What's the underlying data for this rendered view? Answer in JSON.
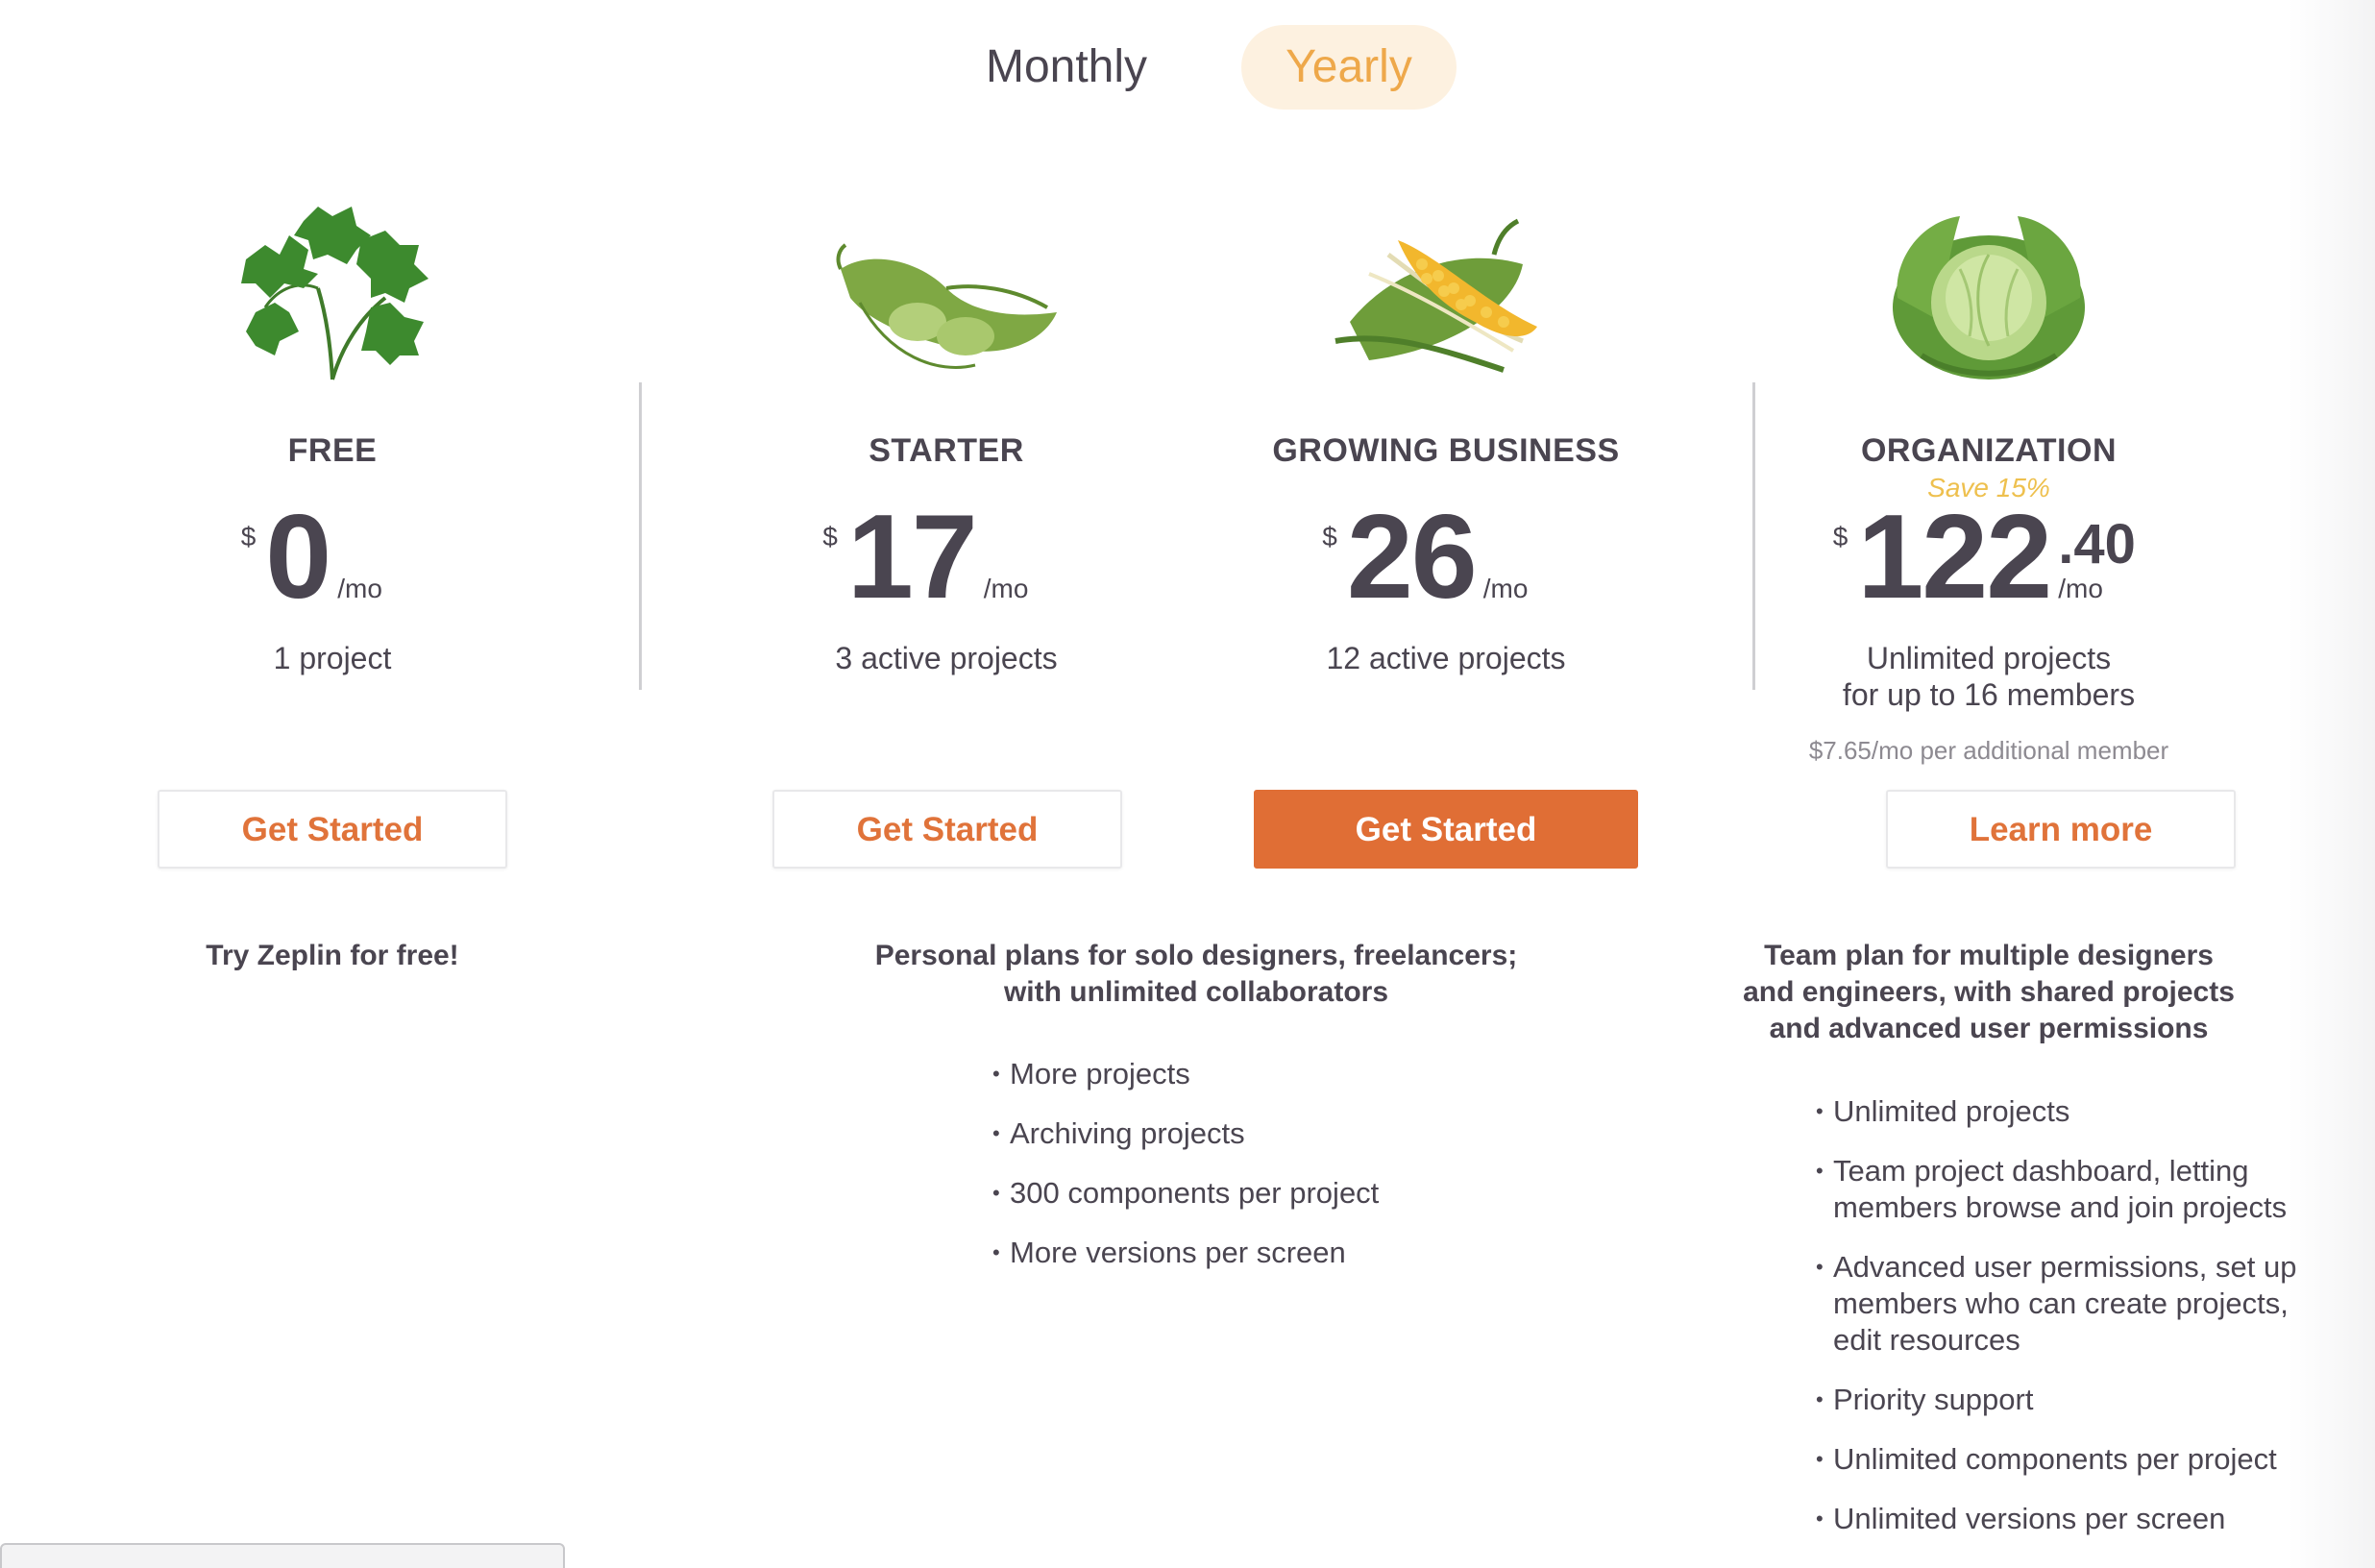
{
  "toggle": {
    "monthly": "Monthly",
    "yearly": "Yearly",
    "selected": "Yearly"
  },
  "plans": [
    {
      "name": "FREE",
      "currency": "$",
      "amount": "0",
      "per": "/mo",
      "projects": "1 project",
      "cta": "Get Started",
      "description": "Try Zeplin for free!",
      "icon": "parsley-image"
    },
    {
      "name": "STARTER",
      "currency": "$",
      "amount": "17",
      "per": "/mo",
      "projects": "3 active projects",
      "cta": "Get Started",
      "icon": "bean-pod-image"
    },
    {
      "name": "GROWING BUSINESS",
      "currency": "$",
      "amount": "26",
      "per": "/mo",
      "projects": "12 active projects",
      "cta": "Get Started",
      "icon": "corn-image"
    },
    {
      "name": "ORGANIZATION",
      "save": "Save 15%",
      "currency": "$",
      "amount": "122",
      "cents": ".40",
      "per": "/mo",
      "projects_line1": "Unlimited projects",
      "projects_line2": "for up to 16 members",
      "extra": "$7.65/mo per additional member",
      "cta": "Learn more",
      "description_line1": "Team plan for multiple designers",
      "description_line2": "and engineers, with shared projects",
      "description_line3": "and advanced user permissions",
      "icon": "cabbage-image"
    }
  ],
  "personal": {
    "description_line1": "Personal plans for solo designers, freelancers;",
    "description_line2": "with unlimited collaborators",
    "features": [
      "More projects",
      "Archiving projects",
      "300 components per project",
      "More versions per screen"
    ]
  },
  "organization_features": {
    "f1": "Unlimited projects",
    "f2_line1": "Team project dashboard, letting",
    "f2_line2": "members browse and join projects",
    "f3_line1": "Advanced user permissions, set up",
    "f3_line2": "members who can create projects,",
    "f3_line3": "edit resources",
    "f4": "Priority support",
    "f5": "Unlimited components per project",
    "f6": "Unlimited versions per screen"
  },
  "colors": {
    "accent": "#e06e35",
    "yearly_text": "#eea84a",
    "yearly_bg": "#fdf1e0",
    "save_text": "#eec04e",
    "text": "#4a4550"
  }
}
